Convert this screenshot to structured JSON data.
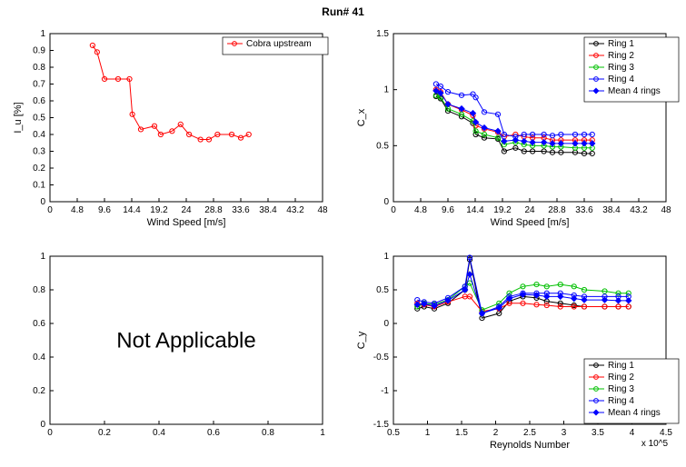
{
  "title": "Run# 41",
  "colors": {
    "ring1": "#000000",
    "ring2": "#ff0000",
    "ring3": "#00c000",
    "ring4": "#0000ff",
    "mean": "#0000ff",
    "cobra": "#ff0000"
  },
  "panel_tl": {
    "xlabel": "Wind Speed [m/s]",
    "ylabel": "I_u [%]",
    "xlim": [
      0,
      48
    ],
    "ylim": [
      0,
      1
    ],
    "xticks": [
      0,
      4.8,
      9.6,
      14.4,
      19.2,
      24,
      28.8,
      33.6,
      38.4,
      43.2,
      48
    ],
    "yticks": [
      0,
      0.1,
      0.2,
      0.3,
      0.4,
      0.5,
      0.6,
      0.7,
      0.8,
      0.9,
      1
    ],
    "legend": [
      "Cobra upstream"
    ]
  },
  "panel_tr": {
    "xlabel": "Wind Speed [m/s]",
    "ylabel": "C_x",
    "xlim": [
      0,
      48
    ],
    "ylim": [
      0,
      1.5
    ],
    "xticks": [
      0,
      4.8,
      9.6,
      14.4,
      19.2,
      24,
      28.8,
      33.6,
      38.4,
      43.2,
      48
    ],
    "yticks": [
      0,
      0.5,
      1,
      1.5
    ],
    "legend": [
      "Ring 1",
      "Ring 2",
      "Ring 3",
      "Ring 4",
      "Mean 4 rings"
    ]
  },
  "panel_bl": {
    "text": "Not Applicable",
    "xlim": [
      0,
      1
    ],
    "ylim": [
      0,
      1
    ],
    "xticks": [
      0,
      0.2,
      0.4,
      0.6,
      0.8,
      1
    ],
    "yticks": [
      0,
      0.2,
      0.4,
      0.6,
      0.8,
      1
    ]
  },
  "panel_br": {
    "xlabel": "Reynolds Number",
    "ylabel": "C_y",
    "xlim": [
      0.5,
      4.5
    ],
    "ylim": [
      -1.5,
      1
    ],
    "xticks": [
      0.5,
      1,
      1.5,
      2,
      2.5,
      3,
      3.5,
      4,
      4.5
    ],
    "yticks": [
      -1.5,
      -1,
      -0.5,
      0,
      0.5,
      1
    ],
    "xexp": "x 10^5",
    "legend": [
      "Ring 1",
      "Ring 2",
      "Ring 3",
      "Ring 4",
      "Mean 4 rings"
    ]
  },
  "chart_data": [
    {
      "type": "line",
      "title": "Cobra upstream turbulence intensity",
      "xlabel": "Wind Speed [m/s]",
      "ylabel": "I_u [%]",
      "x": [
        7.5,
        8.3,
        9.6,
        12.0,
        14.0,
        14.5,
        16.0,
        18.4,
        19.5,
        21.5,
        23.0,
        24.5,
        26.5,
        28.0,
        29.5,
        32.0,
        33.6,
        35.0
      ],
      "series": [
        {
          "name": "Cobra upstream",
          "values": [
            0.93,
            0.89,
            0.73,
            0.73,
            0.73,
            0.52,
            0.43,
            0.45,
            0.4,
            0.42,
            0.46,
            0.4,
            0.37,
            0.37,
            0.4,
            0.4,
            0.38,
            0.4
          ]
        }
      ],
      "xlim": [
        0,
        48
      ],
      "ylim": [
        0,
        1
      ]
    },
    {
      "type": "line",
      "title": "Cx vs Wind Speed",
      "xlabel": "Wind Speed [m/s]",
      "ylabel": "C_x",
      "x": [
        7.5,
        8.3,
        9.6,
        12.0,
        14.0,
        14.5,
        16.0,
        18.4,
        19.5,
        21.5,
        23.0,
        24.5,
        26.5,
        28.0,
        29.5,
        32.0,
        33.6,
        35.0
      ],
      "series": [
        {
          "name": "Ring 1",
          "values": [
            0.94,
            0.92,
            0.81,
            0.76,
            0.7,
            0.6,
            0.57,
            0.56,
            0.45,
            0.48,
            0.45,
            0.45,
            0.45,
            0.44,
            0.44,
            0.44,
            0.43,
            0.43
          ]
        },
        {
          "name": "Ring 2",
          "values": [
            1.0,
            0.98,
            0.87,
            0.82,
            0.77,
            0.68,
            0.65,
            0.62,
            0.58,
            0.6,
            0.58,
            0.57,
            0.57,
            0.55,
            0.55,
            0.55,
            0.55,
            0.55
          ]
        },
        {
          "name": "Ring 3",
          "values": [
            0.95,
            0.93,
            0.83,
            0.78,
            0.72,
            0.63,
            0.6,
            0.57,
            0.51,
            0.53,
            0.51,
            0.5,
            0.5,
            0.49,
            0.49,
            0.48,
            0.48,
            0.48
          ]
        },
        {
          "name": "Ring 4",
          "values": [
            1.05,
            1.03,
            0.98,
            0.95,
            0.96,
            0.93,
            0.8,
            0.78,
            0.6,
            0.58,
            0.6,
            0.6,
            0.6,
            0.59,
            0.6,
            0.6,
            0.6,
            0.6
          ]
        },
        {
          "name": "Mean 4 rings",
          "values": [
            0.99,
            0.97,
            0.87,
            0.83,
            0.79,
            0.71,
            0.66,
            0.63,
            0.54,
            0.55,
            0.54,
            0.53,
            0.53,
            0.52,
            0.52,
            0.52,
            0.52,
            0.52
          ]
        }
      ],
      "xlim": [
        0,
        48
      ],
      "ylim": [
        0,
        1.5
      ]
    },
    {
      "type": "line",
      "title": "Cy vs Reynolds Number",
      "xlabel": "Reynolds Number",
      "ylabel": "C_y",
      "x": [
        0.85,
        0.95,
        1.1,
        1.3,
        1.55,
        1.62,
        1.8,
        2.05,
        2.2,
        2.4,
        2.6,
        2.75,
        2.95,
        3.15,
        3.3,
        3.6,
        3.8,
        3.95
      ],
      "x_scale_note": "multiply x by 1e5",
      "series": [
        {
          "name": "Ring 1",
          "values": [
            0.22,
            0.25,
            0.22,
            0.3,
            0.5,
            0.95,
            0.08,
            0.15,
            0.33,
            0.4,
            0.38,
            0.33,
            0.3,
            0.27,
            0.25,
            0.25,
            0.25,
            0.25
          ]
        },
        {
          "name": "Ring 2",
          "values": [
            0.3,
            0.28,
            0.25,
            0.32,
            0.4,
            0.4,
            0.18,
            0.22,
            0.3,
            0.3,
            0.28,
            0.27,
            0.25,
            0.25,
            0.25,
            0.25,
            0.25,
            0.25
          ]
        },
        {
          "name": "Ring 3",
          "values": [
            0.25,
            0.3,
            0.28,
            0.35,
            0.55,
            0.6,
            0.2,
            0.3,
            0.45,
            0.55,
            0.58,
            0.55,
            0.58,
            0.55,
            0.5,
            0.48,
            0.45,
            0.45
          ]
        },
        {
          "name": "Ring 4",
          "values": [
            0.35,
            0.32,
            0.3,
            0.38,
            0.55,
            0.98,
            0.15,
            0.25,
            0.4,
            0.45,
            0.45,
            0.45,
            0.45,
            0.42,
            0.4,
            0.4,
            0.4,
            0.4
          ]
        },
        {
          "name": "Mean 4 rings",
          "values": [
            0.28,
            0.29,
            0.26,
            0.34,
            0.5,
            0.73,
            0.15,
            0.23,
            0.37,
            0.43,
            0.42,
            0.4,
            0.4,
            0.37,
            0.35,
            0.35,
            0.34,
            0.34
          ]
        }
      ],
      "xlim": [
        0.5,
        4.5
      ],
      "ylim": [
        -1.5,
        1
      ]
    }
  ]
}
